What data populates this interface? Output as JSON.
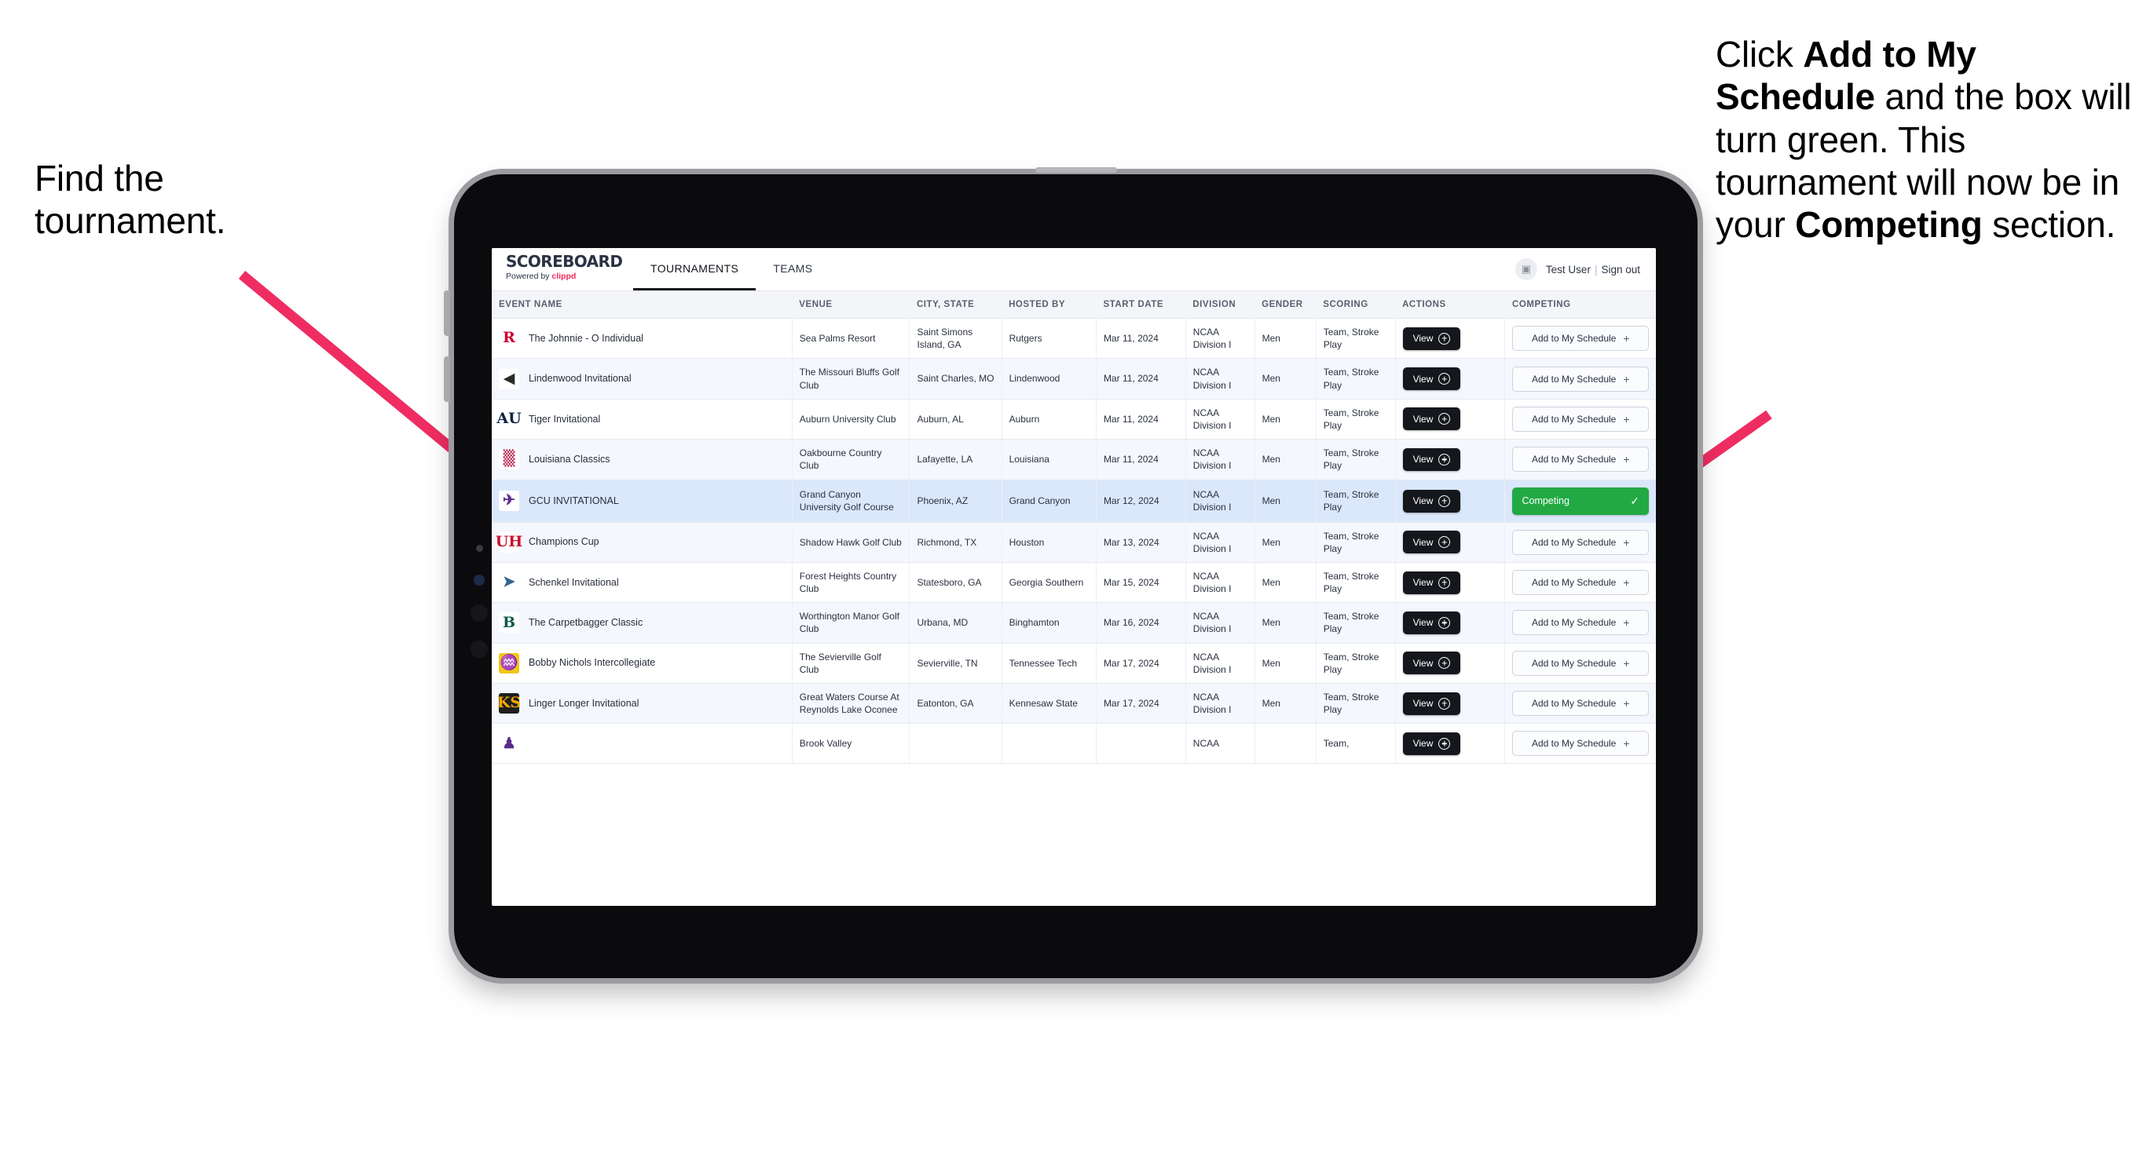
{
  "annotations": {
    "left": {
      "line1": "Find the",
      "line2": "tournament."
    },
    "right": {
      "part1": "Click ",
      "bold1": "Add to My Schedule",
      "part2": " and the box will turn green. This tournament will now be in your ",
      "bold2": "Competing",
      "part3": " section."
    }
  },
  "colors": {
    "arrow": "#ef2d62",
    "competing_green": "#22a944",
    "brand_accent": "#f2295b",
    "selected_row": "#dbe8fb",
    "dark_button": "#15171c"
  },
  "app": {
    "brand": {
      "title": "SCOREBOARD",
      "powered_prefix": "Powered by ",
      "powered_brand": "clippd"
    },
    "nav": {
      "tabs": [
        "TOURNAMENTS",
        "TEAMS"
      ],
      "active": "TOURNAMENTS"
    },
    "user": {
      "name": "Test User",
      "separator": "|",
      "signout": "Sign out",
      "avatar_icon": "user-avatar-icon"
    },
    "table": {
      "columns": [
        "EVENT NAME",
        "VENUE",
        "CITY, STATE",
        "HOSTED BY",
        "START DATE",
        "DIVISION",
        "GENDER",
        "SCORING",
        "ACTIONS",
        "COMPETING"
      ],
      "view_label": "View",
      "add_label": "Add to My Schedule",
      "add_plus": "+",
      "competing_label": "Competing",
      "competing_check": "✓",
      "rows": [
        {
          "logo": {
            "text": "R",
            "color": "#cc0033",
            "bg": "#ffffff"
          },
          "event": "The Johnnie - O Individual",
          "venue": "Sea Palms Resort",
          "city": "Saint Simons Island, GA",
          "host": "Rutgers",
          "date": "Mar 11, 2024",
          "division": "NCAA Division I",
          "gender": "Men",
          "scoring": "Team, Stroke Play",
          "competing": false
        },
        {
          "logo": {
            "text": "◀",
            "color": "#2b2b2b",
            "bg": "#ffffff"
          },
          "event": "Lindenwood Invitational",
          "venue": "The Missouri Bluffs Golf Club",
          "city": "Saint Charles, MO",
          "host": "Lindenwood",
          "date": "Mar 11, 2024",
          "division": "NCAA Division I",
          "gender": "Men",
          "scoring": "Team, Stroke Play",
          "competing": false
        },
        {
          "logo": {
            "text": "AU",
            "color": "#0c2340",
            "bg": "#ffffff"
          },
          "event": "Tiger Invitational",
          "venue": "Auburn University Club",
          "city": "Auburn, AL",
          "host": "Auburn",
          "date": "Mar 11, 2024",
          "division": "NCAA Division I",
          "gender": "Men",
          "scoring": "Team, Stroke Play",
          "competing": false
        },
        {
          "logo": {
            "text": "▒",
            "color": "#b30838",
            "bg": "#ffffff"
          },
          "event": "Louisiana Classics",
          "venue": "Oakbourne Country Club",
          "city": "Lafayette, LA",
          "host": "Louisiana",
          "date": "Mar 11, 2024",
          "division": "NCAA Division I",
          "gender": "Men",
          "scoring": "Team, Stroke Play",
          "competing": false
        },
        {
          "logo": {
            "text": "✈",
            "color": "#5b2b8c",
            "bg": "#ffffff"
          },
          "event": "GCU INVITATIONAL",
          "venue": "Grand Canyon University Golf Course",
          "city": "Phoenix, AZ",
          "host": "Grand Canyon",
          "date": "Mar 12, 2024",
          "division": "NCAA Division I",
          "gender": "Men",
          "scoring": "Team, Stroke Play",
          "competing": true
        },
        {
          "logo": {
            "text": "UH",
            "color": "#c8102e",
            "bg": "#ffffff"
          },
          "event": "Champions Cup",
          "venue": "Shadow Hawk Golf Club",
          "city": "Richmond, TX",
          "host": "Houston",
          "date": "Mar 13, 2024",
          "division": "NCAA Division I",
          "gender": "Men",
          "scoring": "Team, Stroke Play",
          "competing": false
        },
        {
          "logo": {
            "text": "➤",
            "color": "#36648b",
            "bg": "#ffffff"
          },
          "event": "Schenkel Invitational",
          "venue": "Forest Heights Country Club",
          "city": "Statesboro, GA",
          "host": "Georgia Southern",
          "date": "Mar 15, 2024",
          "division": "NCAA Division I",
          "gender": "Men",
          "scoring": "Team, Stroke Play",
          "competing": false
        },
        {
          "logo": {
            "text": "B",
            "color": "#0d5c45",
            "bg": "#ffffff"
          },
          "event": "The Carpetbagger Classic",
          "venue": "Worthington Manor Golf Club",
          "city": "Urbana, MD",
          "host": "Binghamton",
          "date": "Mar 16, 2024",
          "division": "NCAA Division I",
          "gender": "Men",
          "scoring": "Team, Stroke Play",
          "competing": false
        },
        {
          "logo": {
            "text": "♒",
            "color": "#6a2f8f",
            "bg": "#f5c518"
          },
          "event": "Bobby Nichols Intercollegiate",
          "venue": "The Sevierville Golf Club",
          "city": "Sevierville, TN",
          "host": "Tennessee Tech",
          "date": "Mar 17, 2024",
          "division": "NCAA Division I",
          "gender": "Men",
          "scoring": "Team, Stroke Play",
          "competing": false
        },
        {
          "logo": {
            "text": "KS",
            "color": "#f2a900",
            "bg": "#1e1e1e"
          },
          "event": "Linger Longer Invitational",
          "venue": "Great Waters Course At Reynolds Lake Oconee",
          "city": "Eatonton, GA",
          "host": "Kennesaw State",
          "date": "Mar 17, 2024",
          "division": "NCAA Division I",
          "gender": "Men",
          "scoring": "Team, Stroke Play",
          "competing": false
        },
        {
          "logo": {
            "text": "♟",
            "color": "#5b2b8c",
            "bg": "#ffffff"
          },
          "event": "",
          "venue": "Brook Valley",
          "city": "",
          "host": "",
          "date": "",
          "division": "NCAA",
          "gender": "",
          "scoring": "Team,",
          "competing": false,
          "clipped": true
        }
      ]
    }
  }
}
